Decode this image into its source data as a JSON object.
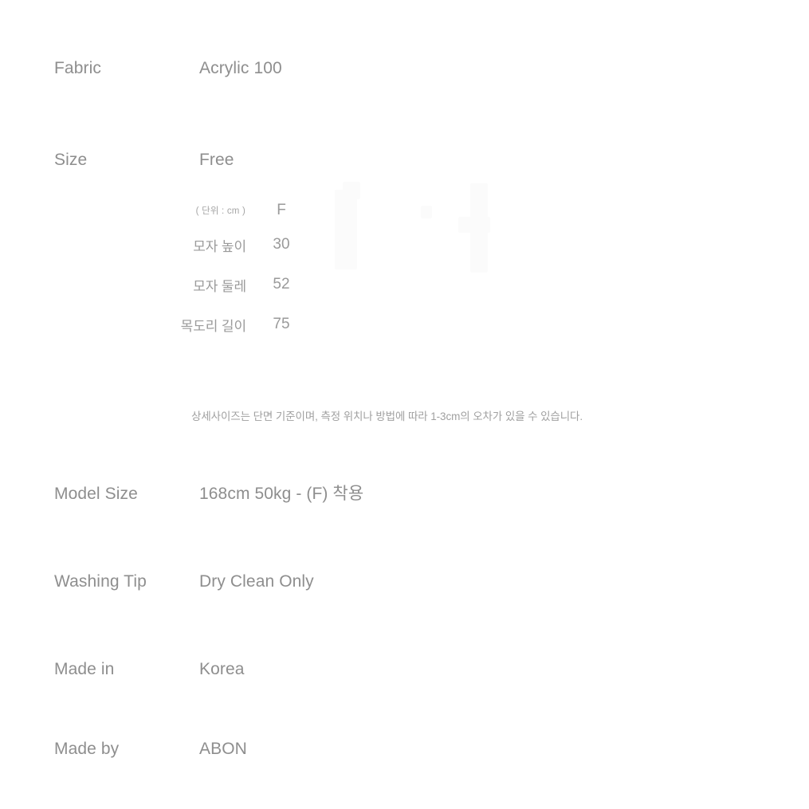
{
  "page": {
    "background_color": "#ffffff",
    "text_color": "#8e8e8e",
    "muted_text_color": "#a0a0a0"
  },
  "spec_rows": [
    {
      "label": "Fabric",
      "value": "Acrylic 100"
    },
    {
      "label": "Size",
      "value": "Free"
    },
    {
      "label": "Model Size",
      "value": "168cm 50kg - (F) 착용"
    },
    {
      "label": "Washing Tip",
      "value": "Dry Clean Only"
    },
    {
      "label": "Made in",
      "value": "Korea"
    },
    {
      "label": "Made by",
      "value": "ABON"
    }
  ],
  "size_table": {
    "unit_note": "( 단위 : cm )",
    "size_column_header": "F",
    "rows": [
      {
        "name": "모자 높이",
        "value": "30"
      },
      {
        "name": "모자 둘레",
        "value": "52"
      },
      {
        "name": "목도리 길이",
        "value": "75"
      }
    ]
  },
  "disclaimer": "상세사이즈는 단면 기준이며, 측정 위치나 방법에 따라 1-3cm의 오차가 있을 수 있습니다."
}
